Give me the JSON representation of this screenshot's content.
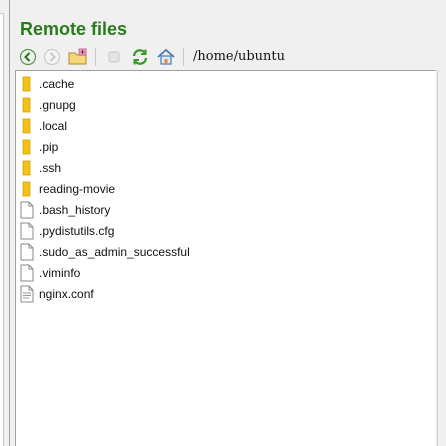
{
  "panel": {
    "title": "Remote files"
  },
  "toolbar": {
    "path": "/home/ubuntu",
    "buttons": [
      "back-icon",
      "forward-icon",
      "new-folder-icon",
      "stop-icon",
      "refresh-icon",
      "home-icon"
    ]
  },
  "files": [
    {
      "name": ".cache",
      "type": "folder"
    },
    {
      "name": ".gnupg",
      "type": "folder"
    },
    {
      "name": ".local",
      "type": "folder"
    },
    {
      "name": ".pip",
      "type": "folder"
    },
    {
      "name": ".ssh",
      "type": "folder"
    },
    {
      "name": "reading-movie",
      "type": "folder"
    },
    {
      "name": ".bash_history",
      "type": "file"
    },
    {
      "name": ".pydistutils.cfg",
      "type": "file"
    },
    {
      "name": ".sudo_as_admin_successful",
      "type": "file"
    },
    {
      "name": ".viminfo",
      "type": "file"
    },
    {
      "name": "nginx.conf",
      "type": "text-file"
    }
  ],
  "colors": {
    "title": "#2a7a1e",
    "folder": "#f2c21b",
    "accent": "#3a9a2a"
  }
}
